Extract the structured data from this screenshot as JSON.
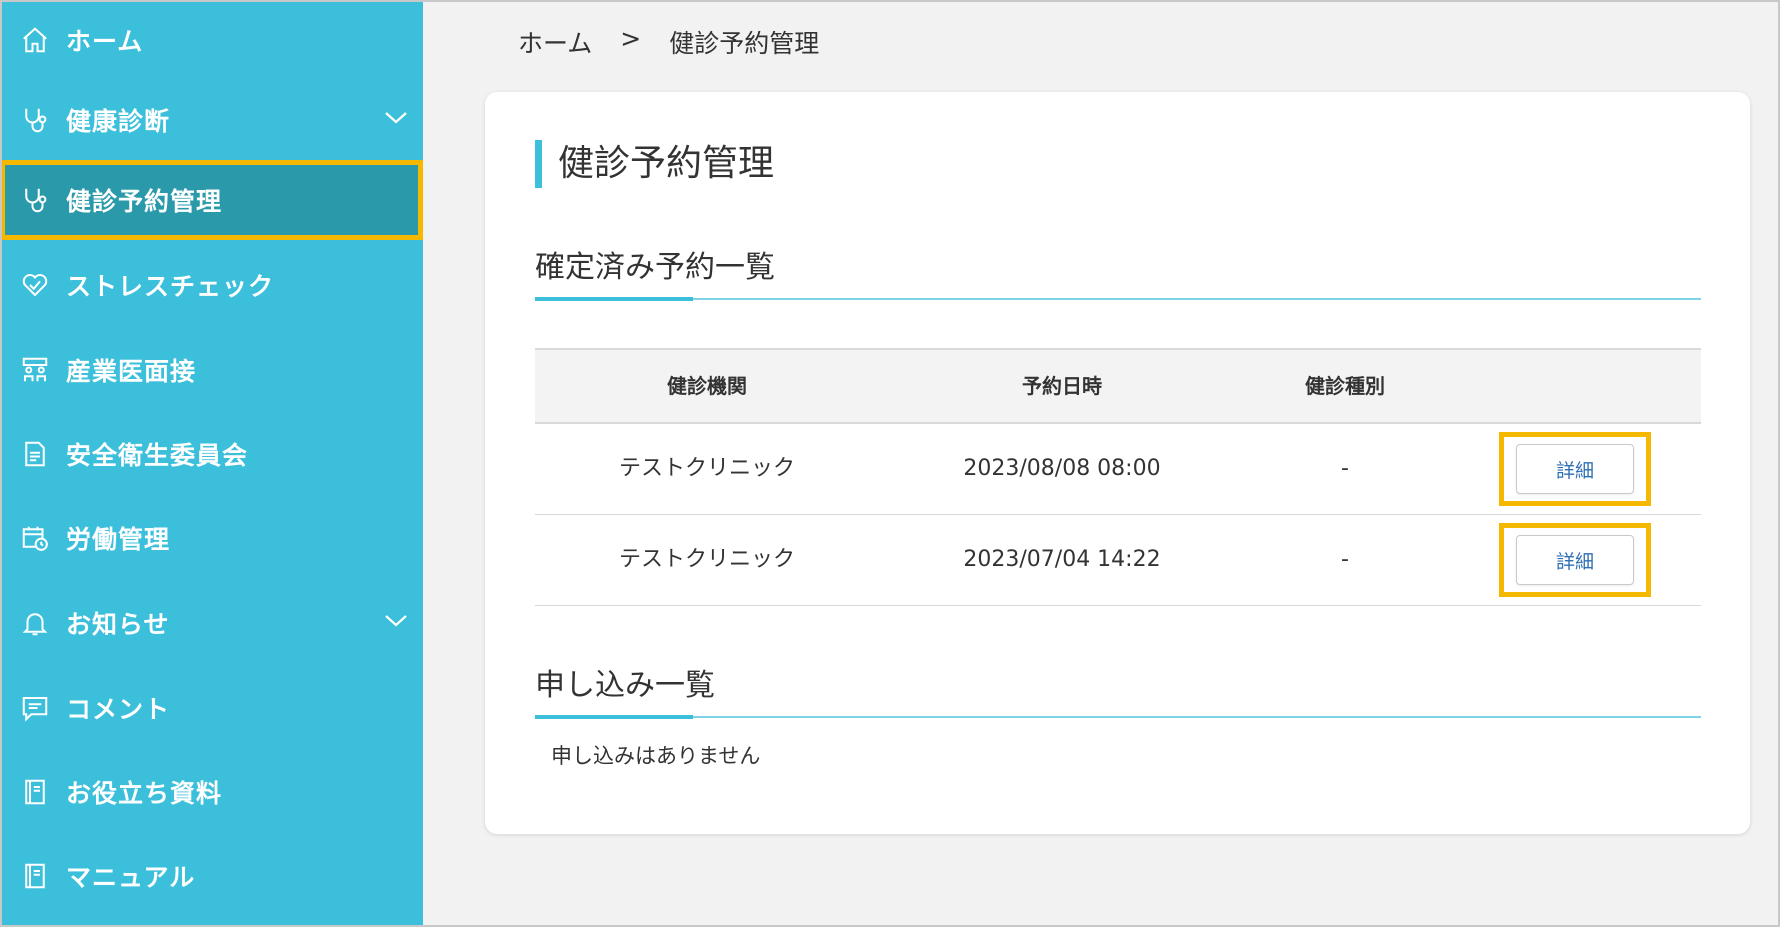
{
  "breadcrumb": {
    "home": "ホーム",
    "separator": ">",
    "current": "健診予約管理"
  },
  "sidebar": {
    "items": [
      {
        "label": "ホーム",
        "icon": "home-icon"
      },
      {
        "label": "健康診断",
        "icon": "stethoscope-icon",
        "expandable": true
      },
      {
        "label": "健診予約管理",
        "icon": "stethoscope-icon",
        "active": true
      },
      {
        "label": "ストレスチェック",
        "icon": "heart-icon"
      },
      {
        "label": "産業医面接",
        "icon": "people-icon"
      },
      {
        "label": "安全衛生委員会",
        "icon": "document-icon"
      },
      {
        "label": "労働管理",
        "icon": "calendar-clock-icon"
      },
      {
        "label": "お知らせ",
        "icon": "bell-icon",
        "expandable": true
      },
      {
        "label": "コメント",
        "icon": "comment-icon"
      },
      {
        "label": "お役立ち資料",
        "icon": "book-icon"
      },
      {
        "label": "マニュアル",
        "icon": "book-icon"
      }
    ]
  },
  "main": {
    "title": "健診予約管理",
    "confirmed": {
      "heading": "確定済み予約一覧",
      "columns": [
        "健診機関",
        "予約日時",
        "健診種別",
        ""
      ],
      "rows": [
        {
          "facility": "テストクリニック",
          "datetime": "2023/08/08 08:00",
          "type": "-",
          "action": "詳細"
        },
        {
          "facility": "テストクリニック",
          "datetime": "2023/07/04 14:22",
          "type": "-",
          "action": "詳細"
        }
      ]
    },
    "applications": {
      "heading": "申し込み一覧",
      "empty_message": "申し込みはありません"
    }
  },
  "colors": {
    "sidebar": "#3cbfdb",
    "active": "#2a9aab",
    "highlight": "#f5b800",
    "link": "#2f6fb3"
  }
}
